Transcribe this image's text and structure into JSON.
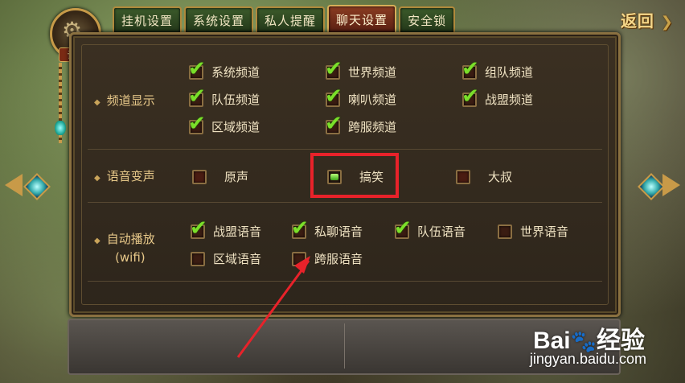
{
  "tabs": [
    {
      "label": "挂机设置",
      "active": false
    },
    {
      "label": "系统设置",
      "active": false
    },
    {
      "label": "私人提醒",
      "active": false
    },
    {
      "label": "聊天设置",
      "active": true
    },
    {
      "label": "安全锁",
      "active": false
    }
  ],
  "back_button": {
    "label": "返回"
  },
  "emblem": {
    "label": "设置",
    "icon": "gear-icon"
  },
  "sections": {
    "channel_display": {
      "title": "频道显示",
      "options": [
        {
          "label": "系统频道",
          "checked": true
        },
        {
          "label": "世界频道",
          "checked": true
        },
        {
          "label": "组队频道",
          "checked": true
        },
        {
          "label": "队伍频道",
          "checked": true
        },
        {
          "label": "喇叭频道",
          "checked": true
        },
        {
          "label": "战盟频道",
          "checked": true
        },
        {
          "label": "区域频道",
          "checked": true
        },
        {
          "label": "跨服频道",
          "checked": true
        }
      ]
    },
    "voice_change": {
      "title": "语音变声",
      "options": [
        {
          "label": "原声",
          "selected": false
        },
        {
          "label": "搞笑",
          "selected": true
        },
        {
          "label": "大叔",
          "selected": false
        }
      ]
    },
    "auto_play": {
      "title": "自动播放",
      "subtitle": "(wifi)",
      "options": [
        {
          "label": "战盟语音",
          "checked": true
        },
        {
          "label": "私聊语音",
          "checked": true
        },
        {
          "label": "队伍语音",
          "checked": true
        },
        {
          "label": "世界语音",
          "checked": false
        },
        {
          "label": "区域语音",
          "checked": false
        },
        {
          "label": "跨服语音",
          "checked": false
        }
      ]
    }
  },
  "watermark": {
    "brand": "Bai",
    "brand_suffix": "经验",
    "url": "jingyan.baidu.com"
  },
  "colors": {
    "accent_gold": "#c89a48",
    "check_green": "#7adf2a",
    "highlight_red": "#e8222a",
    "active_tab": "#8a3c22"
  }
}
